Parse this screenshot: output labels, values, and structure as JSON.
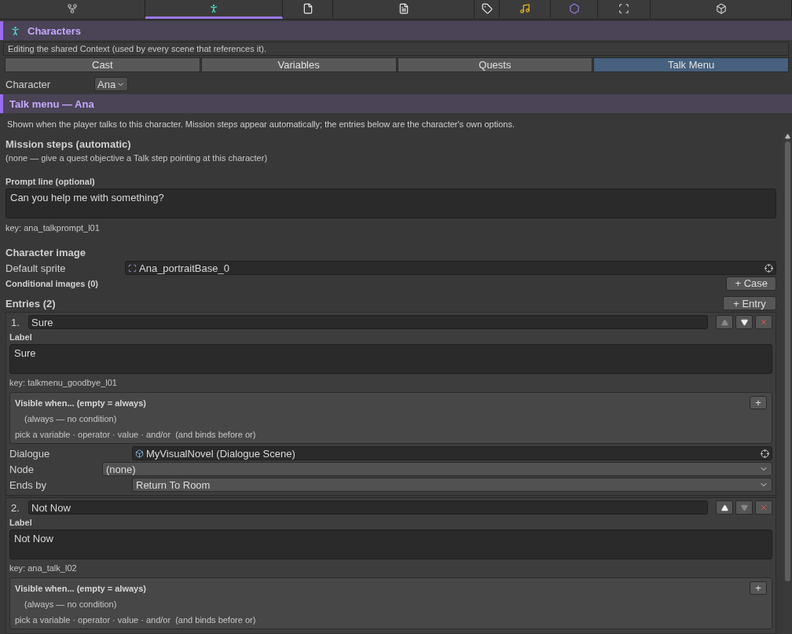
{
  "toolbar_tabs": [
    {
      "selected": false
    },
    {
      "selected": true
    },
    {
      "selected": false
    },
    {
      "selected": false
    },
    {
      "selected": false
    },
    {
      "selected": false
    },
    {
      "selected": false
    },
    {
      "selected": false
    },
    {
      "selected": false
    }
  ],
  "section_header": {
    "title": "Characters"
  },
  "context_note": "Editing the shared Context (used by every scene that references it).",
  "sub_tabs": [
    {
      "label": "Cast",
      "selected": false
    },
    {
      "label": "Variables",
      "selected": false
    },
    {
      "label": "Quests",
      "selected": false
    },
    {
      "label": "Talk Menu",
      "selected": true
    }
  ],
  "character": {
    "label": "Character",
    "value": "Ana"
  },
  "talk_menu": {
    "title": "Talk menu — Ana",
    "description": "Shown when the player talks to this character. Mission steps appear automatically; the entries below are the character's own options.",
    "mission_steps": {
      "title": "Mission steps (automatic)",
      "note": "(none — give a quest objective a Talk step pointing at this character)"
    },
    "prompt": {
      "label": "Prompt line (optional)",
      "value": "Can you help me with something?",
      "key": "key: ana_talkprompt_l01"
    },
    "character_image": {
      "title": "Character image",
      "default_sprite": {
        "label": "Default sprite",
        "value": "Ana_portraitBase_0"
      },
      "conditional_images": {
        "label": "Conditional images (0)",
        "button": "+ Case"
      }
    },
    "entries": {
      "title": "Entries (2)",
      "add_button": "+ Entry",
      "items": [
        {
          "number": "1.",
          "name": "Sure",
          "can_move_up": false,
          "can_move_down": true,
          "label_title": "Label",
          "label": "Sure",
          "key": "key: talkmenu_goodbye_l01",
          "visible_when": {
            "title": "Visible when... (empty = always)",
            "add": "+",
            "condition": "(always — no condition)",
            "hint": "pick a variable · operator · value · and/or  (and binds before or)"
          },
          "dialogue": {
            "label": "Dialogue",
            "value": "MyVisualNovel (Dialogue Scene)"
          },
          "node": {
            "label": "Node",
            "value": "(none)"
          },
          "ends_by": {
            "label": "Ends by",
            "value": "Return To Room"
          }
        },
        {
          "number": "2.",
          "name": "Not Now",
          "can_move_up": true,
          "can_move_down": false,
          "label_title": "Label",
          "label": "Not Now",
          "key": "key: ana_talk_l02",
          "visible_when": {
            "title": "Visible when... (empty = always)",
            "add": "+",
            "condition": "(always — no condition)",
            "hint": "pick a variable · operator · value · and/or  (and binds before or)"
          }
        }
      ]
    }
  }
}
